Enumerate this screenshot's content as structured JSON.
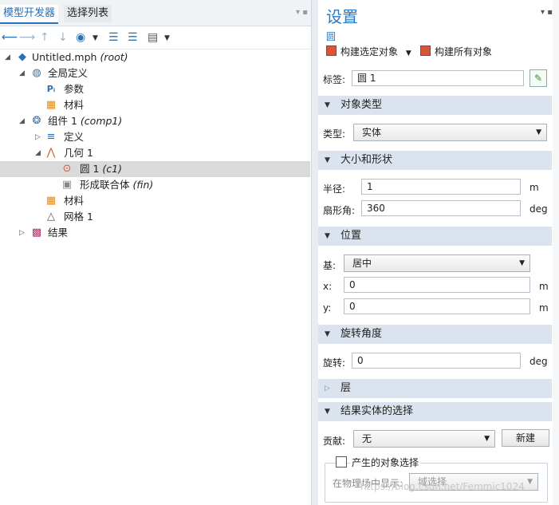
{
  "left_panel": {
    "tabs": [
      "模型开发器",
      "选择列表"
    ],
    "tab_controls": "▾ ▪",
    "tree": [
      {
        "text": "Untitled.mph",
        "suffix": "(root)"
      },
      {
        "text": "全局定义",
        "suffix": ""
      },
      {
        "text": "参数",
        "suffix": ""
      },
      {
        "text": "材料",
        "suffix": ""
      },
      {
        "text": "组件 1",
        "suffix": "(comp1)"
      },
      {
        "text": "定义",
        "suffix": ""
      },
      {
        "text": "几何 1",
        "suffix": ""
      },
      {
        "text": "圆 1",
        "suffix": "(c1)"
      },
      {
        "text": "形成联合体",
        "suffix": "(fin)"
      },
      {
        "text": "材料",
        "suffix": ""
      },
      {
        "text": "网格 1",
        "suffix": ""
      },
      {
        "text": "结果",
        "suffix": ""
      }
    ]
  },
  "settings": {
    "title": "设置",
    "subtitle": "圆",
    "build_selected": "构建选定对象",
    "build_all": "构建所有对象",
    "label_caption": "标签:",
    "label_value": "圆 1",
    "sections": {
      "object_type": "对象类型",
      "size_shape": "大小和形状",
      "position": "位置",
      "rotation": "旋转角度",
      "layers": "层",
      "result_selection": "结果实体的选择"
    },
    "type_caption": "类型:",
    "type_value": "实体",
    "radius_caption": "半径:",
    "radius_value": "1",
    "radius_unit": "m",
    "sector_caption": "扇形角:",
    "sector_value": "360",
    "sector_unit": "deg",
    "base_caption": "基:",
    "base_value": "居中",
    "x_caption": "x:",
    "x_value": "0",
    "x_unit": "m",
    "y_caption": "y:",
    "y_value": "0",
    "y_unit": "m",
    "rotation_caption": "旋转:",
    "rotation_value": "0",
    "rotation_unit": "deg",
    "contribute_caption": "贡献:",
    "contribute_value": "无",
    "new_button": "新建",
    "resulting_selection_checkbox": "产生的对象选择",
    "show_in_physics_caption": "在物理场中显示:",
    "show_in_physics_value": "域选择"
  },
  "watermark": "https://blog.csdn.net/Femmic1024"
}
